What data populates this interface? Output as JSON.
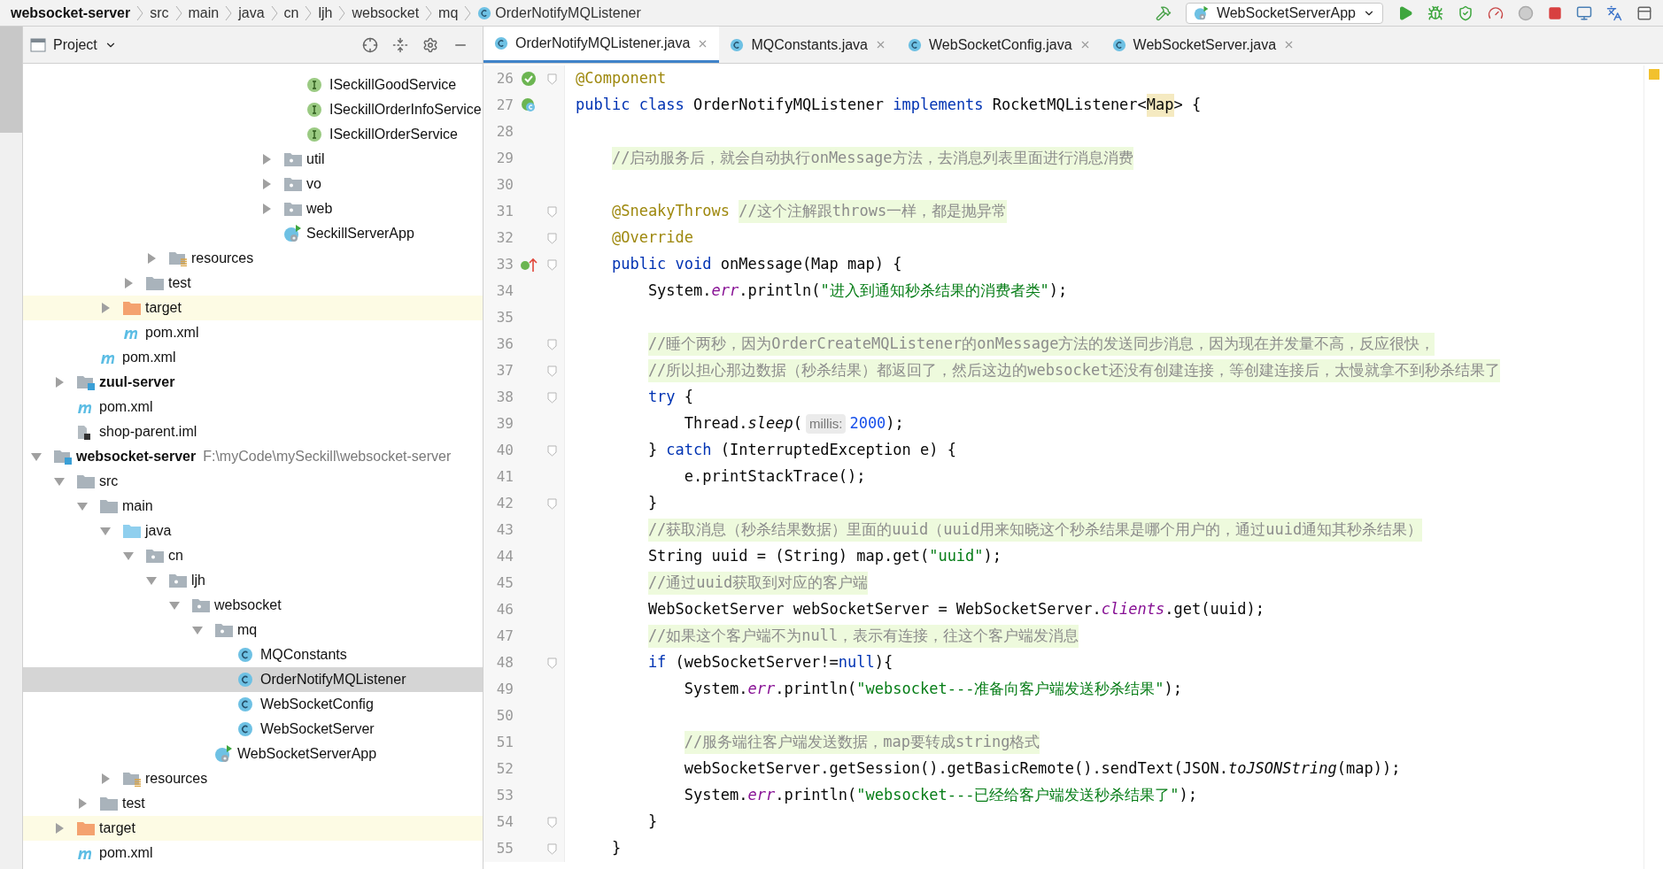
{
  "breadcrumbs": [
    {
      "label": "websocket-server",
      "kind": "module"
    },
    {
      "label": "src",
      "kind": "folder"
    },
    {
      "label": "main",
      "kind": "folder"
    },
    {
      "label": "java",
      "kind": "folder"
    },
    {
      "label": "cn",
      "kind": "folder"
    },
    {
      "label": "ljh",
      "kind": "folder"
    },
    {
      "label": "websocket",
      "kind": "folder"
    },
    {
      "label": "mq",
      "kind": "folder"
    },
    {
      "label": "OrderNotifyMQListener",
      "kind": "class"
    }
  ],
  "run_config": "WebSocketServerApp",
  "project_panel": {
    "title": "Project"
  },
  "project_tree": [
    {
      "children": [
        {
          "children": [
            {
              "children": [
                {
                  "children": [
                    {
                      "children": [
                        {
                          "children": [
                            {
                              "children": [
                                {
                                  "children": [
                                    {
                                      "children": [
                                        {
                                          "children": [
                                            {
                                              "children": [
                                                {
                                                  "label": "ISeckillGoodService",
                                                  "kind": "interface",
                                                  "selected": false
                                                },
                                                {
                                                  "label": "ISeckillOrderInfoService",
                                                  "kind": "interface",
                                                  "selected": false
                                                },
                                                {
                                                  "label": "ISeckillOrderService",
                                                  "kind": "interface",
                                                  "selected": false
                                                }
                                              ]
                                            },
                                            {
                                              "label": "util",
                                              "kind": "package",
                                              "expanded": false,
                                              "selected": false
                                            },
                                            {
                                              "label": "vo",
                                              "kind": "package",
                                              "expanded": false,
                                              "selected": false
                                            },
                                            {
                                              "label": "web",
                                              "kind": "package",
                                              "expanded": false,
                                              "selected": false
                                            },
                                            {
                                              "label": "SeckillServerApp",
                                              "kind": "app",
                                              "selected": false
                                            }
                                          ]
                                        }
                                      ]
                                    }
                                  ]
                                }
                              ]
                            }
                          ]
                        },
                        {
                          "label": "resources",
                          "kind": "resources",
                          "expanded": false,
                          "selected": false
                        }
                      ]
                    },
                    {
                      "label": "test",
                      "kind": "folder",
                      "expanded": false,
                      "selected": false
                    }
                  ]
                },
                {
                  "label": "target",
                  "kind": "target",
                  "expanded": false,
                  "selected": false
                },
                {
                  "label": "pom.xml",
                  "kind": "maven",
                  "selected": false
                }
              ]
            },
            {
              "label": "pom.xml",
              "kind": "maven",
              "selected": false
            }
          ]
        },
        {
          "label": "zuul-server",
          "kind": "module",
          "expanded": false,
          "selected": false
        },
        {
          "label": "pom.xml",
          "kind": "maven",
          "selected": false
        },
        {
          "label": "shop-parent.iml",
          "kind": "iml",
          "selected": false
        }
      ]
    },
    {
      "label": "websocket-server",
      "kind": "module",
      "path": "F:\\myCode\\mySeckill\\websocket-server",
      "expanded": true,
      "selected": false,
      "children": [
        {
          "label": "src",
          "kind": "folder",
          "expanded": true,
          "selected": false,
          "children": [
            {
              "label": "main",
              "kind": "folder",
              "expanded": true,
              "selected": false,
              "children": [
                {
                  "label": "java",
                  "kind": "source-root",
                  "expanded": true,
                  "selected": false,
                  "children": [
                    {
                      "label": "cn",
                      "kind": "package",
                      "expanded": true,
                      "selected": false,
                      "children": [
                        {
                          "label": "ljh",
                          "kind": "package",
                          "expanded": true,
                          "selected": false,
                          "children": [
                            {
                              "label": "websocket",
                              "kind": "package",
                              "expanded": true,
                              "selected": false,
                              "children": [
                                {
                                  "label": "mq",
                                  "kind": "package",
                                  "expanded": true,
                                  "selected": false,
                                  "children": [
                                    {
                                      "label": "MQConstants",
                                      "kind": "class",
                                      "selected": false
                                    },
                                    {
                                      "label": "OrderNotifyMQListener",
                                      "kind": "class",
                                      "selected": true
                                    },
                                    {
                                      "label": "WebSocketConfig",
                                      "kind": "class",
                                      "selected": false
                                    },
                                    {
                                      "label": "WebSocketServer",
                                      "kind": "class",
                                      "selected": false
                                    }
                                  ]
                                },
                                {
                                  "label": "WebSocketServerApp",
                                  "kind": "app",
                                  "selected": false
                                }
                              ]
                            }
                          ]
                        }
                      ]
                    }
                  ]
                },
                {
                  "label": "resources",
                  "kind": "resources",
                  "expanded": false,
                  "selected": false
                }
              ]
            },
            {
              "label": "test",
              "kind": "folder",
              "expanded": false,
              "selected": false
            }
          ]
        },
        {
          "label": "target",
          "kind": "target",
          "expanded": false,
          "selected": false
        },
        {
          "label": "pom.xml",
          "kind": "maven",
          "selected": false
        }
      ]
    }
  ],
  "tabs": [
    {
      "label": "OrderNotifyMQListener.java",
      "selected": true
    },
    {
      "label": "MQConstants.java",
      "selected": false
    },
    {
      "label": "WebSocketConfig.java",
      "selected": false
    },
    {
      "label": "WebSocketServer.java",
      "selected": false
    }
  ],
  "code_lines": [
    {
      "number": "26",
      "gutter": {
        "kind": "bean"
      },
      "fold": true,
      "tokens": [
        {
          "kind": "annotation",
          "text": "@Component"
        }
      ]
    },
    {
      "number": "27",
      "gutter": {
        "kind": "bean-class"
      },
      "fold": false,
      "tokens": [
        {
          "kind": "keyword",
          "text": "public class"
        },
        {
          "kind": "plain",
          "text": " OrderNotifyMQListener "
        },
        {
          "kind": "keyword",
          "text": "implements"
        },
        {
          "kind": "plain",
          "text": " RocketMQListener<"
        },
        {
          "kind": "highlight",
          "text": "Map"
        },
        {
          "kind": "plain",
          "text": "> {"
        }
      ],
      "children": [
        {
          "number": "28",
          "fold": false
        },
        {
          "number": "29",
          "fold": false,
          "tokens": [
            {
              "kind": "comment",
              "text": "//启动服务后，就会自动执行onMessage方法，去消息列表里面进行消息消费"
            }
          ]
        },
        {
          "number": "30",
          "fold": false
        },
        {
          "number": "31",
          "fold": true,
          "tokens": [
            {
              "kind": "annotation",
              "text": "@SneakyThrows "
            },
            {
              "kind": "comment",
              "text": "//这个注解跟throws一样，都是抛异常"
            }
          ]
        },
        {
          "number": "32",
          "fold": true,
          "tokens": [
            {
              "kind": "annotation",
              "text": "@Override"
            }
          ]
        },
        {
          "number": "33",
          "gutter": {
            "kind": "override"
          },
          "fold": true,
          "tokens": [
            {
              "kind": "keyword",
              "text": "public void"
            },
            {
              "kind": "plain",
              "text": " onMessage(Map map) {"
            }
          ],
          "children": [
            {
              "number": "34",
              "fold": false,
              "tokens": [
                {
                  "kind": "plain",
                  "text": "System."
                },
                {
                  "kind": "field",
                  "text": "err"
                },
                {
                  "kind": "plain",
                  "text": ".println("
                },
                {
                  "kind": "string",
                  "text": "\"进入到通知秒杀结果的消费者类\""
                },
                {
                  "kind": "plain",
                  "text": ");"
                }
              ]
            },
            {
              "number": "35",
              "fold": false
            },
            {
              "number": "36",
              "fold": true,
              "tokens": [
                {
                  "kind": "comment",
                  "text": "//睡个两秒，因为OrderCreateMQListener的onMessage方法的发送同步消息，因为现在并发量不高，反应很快，"
                }
              ]
            },
            {
              "number": "37",
              "fold": true,
              "tokens": [
                {
                  "kind": "comment",
                  "text": "//所以担心那边数据（秒杀结果）都返回了，然后这边的websocket还没有创建连接，等创建连接后，太慢就拿不到秒杀结果了"
                }
              ]
            },
            {
              "number": "38",
              "fold": true,
              "tokens": [
                {
                  "kind": "keyword",
                  "text": "try"
                },
                {
                  "kind": "plain",
                  "text": " {"
                }
              ],
              "children": [
                {
                  "number": "39",
                  "fold": false,
                  "tokens": [
                    {
                      "kind": "plain",
                      "text": "Thread."
                    },
                    {
                      "kind": "method",
                      "text": "sleep"
                    },
                    {
                      "kind": "plain",
                      "text": "("
                    },
                    {
                      "kind": "hint",
                      "text": "millis:"
                    },
                    {
                      "kind": "number",
                      "text": "2000"
                    },
                    {
                      "kind": "plain",
                      "text": ");"
                    }
                  ]
                }
              ]
            },
            {
              "number": "40",
              "fold": true,
              "tokens": [
                {
                  "kind": "plain",
                  "text": "} "
                },
                {
                  "kind": "keyword",
                  "text": "catch"
                },
                {
                  "kind": "plain",
                  "text": " (InterruptedException e) {"
                }
              ],
              "children": [
                {
                  "number": "41",
                  "fold": false,
                  "tokens": [
                    {
                      "kind": "plain",
                      "text": "e.printStackTrace();"
                    }
                  ]
                }
              ]
            },
            {
              "number": "42",
              "fold": true,
              "tokens": [
                {
                  "kind": "plain",
                  "text": "}"
                }
              ]
            },
            {
              "number": "43",
              "fold": false,
              "tokens": [
                {
                  "kind": "comment",
                  "text": "//获取消息（秒杀结果数据）里面的uuid（uuid用来知晓这个秒杀结果是哪个用户的，通过uuid通知其秒杀结果）"
                }
              ]
            },
            {
              "number": "44",
              "fold": false,
              "tokens": [
                {
                  "kind": "plain",
                  "text": "String uuid = (String) map.get("
                },
                {
                  "kind": "string",
                  "text": "\"uuid\""
                },
                {
                  "kind": "plain",
                  "text": ");"
                }
              ]
            },
            {
              "number": "45",
              "fold": false,
              "tokens": [
                {
                  "kind": "comment",
                  "text": "//通过uuid获取到对应的客户端"
                }
              ]
            },
            {
              "number": "46",
              "fold": false,
              "tokens": [
                {
                  "kind": "plain",
                  "text": "WebSocketServer webSocketServer = WebSocketServer."
                },
                {
                  "kind": "field",
                  "text": "clients"
                },
                {
                  "kind": "plain",
                  "text": ".get(uuid);"
                }
              ]
            },
            {
              "number": "47",
              "fold": false,
              "tokens": [
                {
                  "kind": "comment",
                  "text": "//如果这个客户端不为null，表示有连接，往这个客户端发消息"
                }
              ]
            },
            {
              "number": "48",
              "fold": true,
              "tokens": [
                {
                  "kind": "keyword",
                  "text": "if"
                },
                {
                  "kind": "plain",
                  "text": " (webSocketServer!="
                },
                {
                  "kind": "keyword",
                  "text": "null"
                },
                {
                  "kind": "plain",
                  "text": "){"
                }
              ],
              "children": [
                {
                  "number": "49",
                  "fold": false,
                  "tokens": [
                    {
                      "kind": "plain",
                      "text": "System."
                    },
                    {
                      "kind": "field",
                      "text": "err"
                    },
                    {
                      "kind": "plain",
                      "text": ".println("
                    },
                    {
                      "kind": "string",
                      "text": "\"websocket---准备向客户端发送秒杀结果\""
                    },
                    {
                      "kind": "plain",
                      "text": ");"
                    }
                  ]
                },
                {
                  "number": "50",
                  "fold": false
                },
                {
                  "number": "51",
                  "fold": false,
                  "tokens": [
                    {
                      "kind": "comment",
                      "text": "//服务端往客户端发送数据，map要转成string格式"
                    }
                  ]
                },
                {
                  "number": "52",
                  "fold": false,
                  "tokens": [
                    {
                      "kind": "plain",
                      "text": "webSocketServer.getSession().getBasicRemote().sendText(JSON."
                    },
                    {
                      "kind": "method",
                      "text": "toJSONString"
                    },
                    {
                      "kind": "plain",
                      "text": "(map));"
                    }
                  ]
                },
                {
                  "number": "53",
                  "fold": false,
                  "tokens": [
                    {
                      "kind": "plain",
                      "text": "System."
                    },
                    {
                      "kind": "field",
                      "text": "err"
                    },
                    {
                      "kind": "plain",
                      "text": ".println("
                    },
                    {
                      "kind": "string",
                      "text": "\"websocket---已经给客户端发送秒杀结果了\""
                    },
                    {
                      "kind": "plain",
                      "text": ");"
                    }
                  ]
                }
              ]
            },
            {
              "number": "54",
              "fold": true,
              "tokens": [
                {
                  "kind": "plain",
                  "text": "}"
                }
              ]
            }
          ]
        },
        {
          "number": "55",
          "fold": true,
          "tokens": [
            {
              "kind": "plain",
              "text": "}"
            }
          ]
        }
      ]
    }
  ]
}
